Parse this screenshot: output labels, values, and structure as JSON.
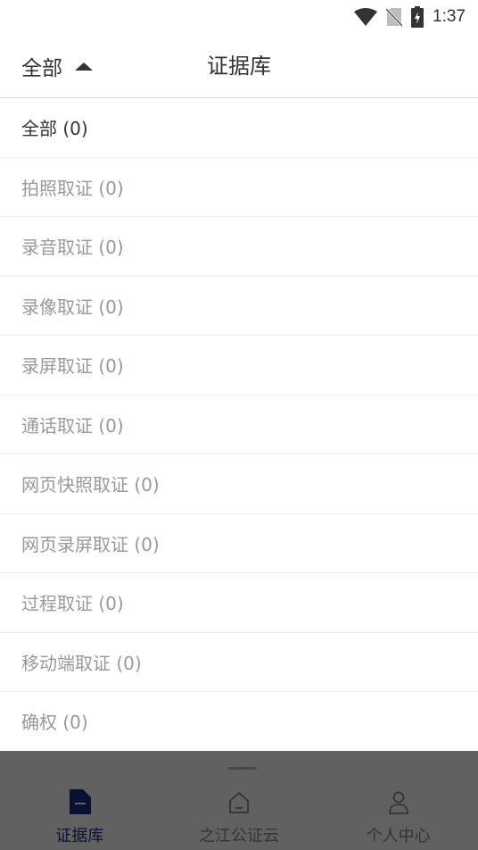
{
  "status_bar": {
    "time": "1:37",
    "icons": [
      "wifi-icon",
      "no-sim-icon",
      "battery-charging-icon"
    ]
  },
  "header": {
    "filter_label": "全部",
    "title": "证据库"
  },
  "filter_list": {
    "items": [
      {
        "label": "全部 (0)",
        "selected": true
      },
      {
        "label": "拍照取证 (0)",
        "selected": false
      },
      {
        "label": "录音取证 (0)",
        "selected": false
      },
      {
        "label": "录像取证 (0)",
        "selected": false
      },
      {
        "label": "录屏取证 (0)",
        "selected": false
      },
      {
        "label": "通话取证 (0)",
        "selected": false
      },
      {
        "label": "网页快照取证 (0)",
        "selected": false
      },
      {
        "label": "网页录屏取证 (0)",
        "selected": false
      },
      {
        "label": "过程取证 (0)",
        "selected": false
      },
      {
        "label": "移动端取证 (0)",
        "selected": false
      },
      {
        "label": "确权 (0)",
        "selected": false
      }
    ]
  },
  "tab_bar": {
    "tabs": [
      {
        "label": "证据库",
        "icon": "document-icon",
        "active": true
      },
      {
        "label": "之江公证云",
        "icon": "home-icon",
        "active": false
      },
      {
        "label": "个人中心",
        "icon": "person-icon",
        "active": false
      }
    ]
  },
  "colors": {
    "accent": "#1b2a8a",
    "inactive_text": "#999999",
    "overlay": "rgba(0,0,0,0.62)"
  }
}
